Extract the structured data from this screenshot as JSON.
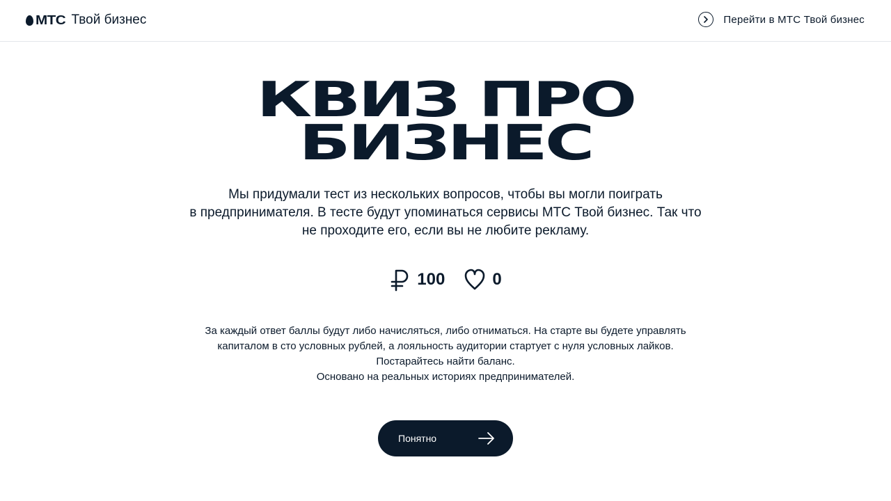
{
  "header": {
    "logo_mark": "МТС",
    "logo_text": "Твой бизнес",
    "goto_label": "Перейти в МТС Твой бизнес"
  },
  "hero": {
    "title_line1": "КВИЗ ПРО",
    "title_line2": "БИЗНЕС",
    "intro_line1": "Мы придумали тест из нескольких вопросов, чтобы вы могли поиграть",
    "intro_line2": "в предпринимателя. В тесте будут упоминаться сервисы МТС Твой бизнес. Так что",
    "intro_line3": "не проходите его, если вы не любите рекламу."
  },
  "stats": {
    "capital": {
      "icon": "ruble-icon",
      "value": "100"
    },
    "likes": {
      "icon": "heart-icon",
      "value": "0"
    }
  },
  "rules": {
    "line1": "За каждый ответ баллы будут либо начисляться, либо отниматься. На старте вы будете управлять",
    "line2": "капиталом в сто условных рублей, а лояльность аудитории стартует с нуля условных лайков.",
    "line3": "Постарайтесь найти баланс.",
    "line4": "Основано на реальных историях предпринимателей."
  },
  "cta": {
    "label": "Понятно",
    "icon": "arrow-right-icon"
  },
  "colors": {
    "primary": "#0b1a2b",
    "background": "#ffffff",
    "divider": "#e3e6ea"
  }
}
